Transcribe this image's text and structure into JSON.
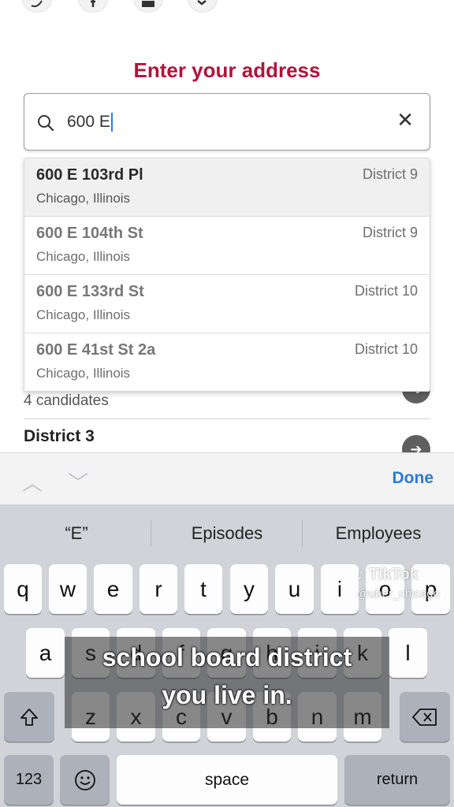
{
  "page": {
    "title": "Enter your address"
  },
  "share": {
    "icons": [
      "twitter-icon",
      "facebook-icon",
      "email-icon",
      "share-icon"
    ]
  },
  "search": {
    "value": "600 E",
    "icon": "search-icon",
    "clear_icon": "close-icon"
  },
  "results": [
    {
      "street": "600 E 103rd Pl",
      "city": "Chicago, Illinois",
      "district": "District 9"
    },
    {
      "street": "600 E 104th St",
      "city": "Chicago, Illinois",
      "district": "District 9"
    },
    {
      "street": "600 E 133rd St",
      "city": "Chicago, Illinois",
      "district": "District 10"
    },
    {
      "street": "600 E 41st St 2a",
      "city": "Chicago, Illinois",
      "district": "District 10"
    }
  ],
  "background": {
    "candidates": "4 candidates",
    "district": "District 3"
  },
  "toolbar": {
    "done": "Done"
  },
  "keyboard": {
    "suggestions": [
      "“E”",
      "Episodes",
      "Employees"
    ],
    "row1": [
      "q",
      "w",
      "e",
      "r",
      "t",
      "y",
      "u",
      "i",
      "o",
      "p"
    ],
    "row2": [
      "a",
      "s",
      "d",
      "f",
      "g",
      "h",
      "j",
      "k",
      "l"
    ],
    "row3": [
      "z",
      "x",
      "c",
      "v",
      "b",
      "n",
      "m"
    ],
    "numbers": "123",
    "space": "space",
    "return": "return"
  },
  "caption": {
    "line1": "school board district",
    "line2": "you live in."
  },
  "watermark": {
    "brand": "TikTok",
    "handle": "@uber_chicago"
  },
  "colors": {
    "title": "#b3123a",
    "done": "#2b7bd6",
    "keyboard_bg": "#d1d3d9"
  }
}
